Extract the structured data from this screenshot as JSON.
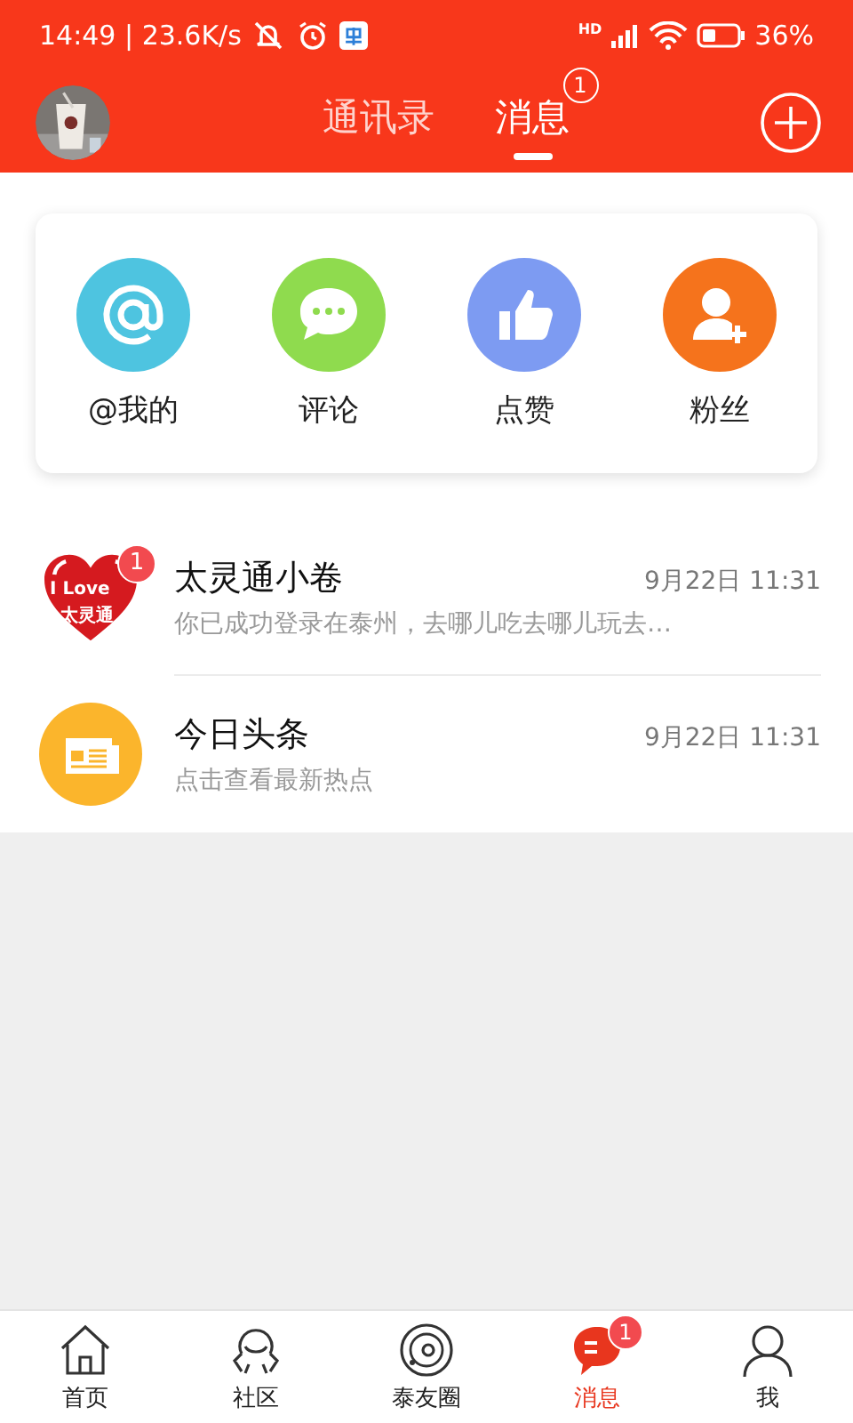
{
  "status_bar": {
    "time": "14:49 | 23.6K/s",
    "network_label": "HD",
    "battery": "36%"
  },
  "header": {
    "tabs": [
      {
        "label": "通讯录",
        "selected": false
      },
      {
        "label": "消息",
        "selected": true,
        "badge": "1"
      }
    ]
  },
  "shortcuts": [
    {
      "label": "@我的",
      "kind": "at",
      "color": "#4ec4e0"
    },
    {
      "label": "评论",
      "kind": "comment",
      "color": "#8fdb4e"
    },
    {
      "label": "点赞",
      "kind": "like",
      "color": "#7d9bf2"
    },
    {
      "label": "粉丝",
      "kind": "fans",
      "color": "#f5731c"
    }
  ],
  "messages": [
    {
      "kind": "heart",
      "logo_text": [
        "I Love",
        "太灵通"
      ],
      "badge": "1",
      "title": "太灵通小卷",
      "time": "9月22日 11:31",
      "preview": "你已成功登录在泰州，去哪儿吃去哪儿玩去…"
    },
    {
      "kind": "news",
      "title": "今日头条",
      "time": "9月22日 11:31",
      "preview": "点击查看最新热点"
    }
  ],
  "nav": [
    {
      "label": "首页",
      "kind": "home",
      "selected": false
    },
    {
      "label": "社区",
      "kind": "community",
      "selected": false
    },
    {
      "label": "泰友圈",
      "kind": "circle",
      "selected": false
    },
    {
      "label": "消息",
      "kind": "message",
      "selected": true,
      "badge": "1"
    },
    {
      "label": "我",
      "kind": "me",
      "selected": false
    }
  ]
}
